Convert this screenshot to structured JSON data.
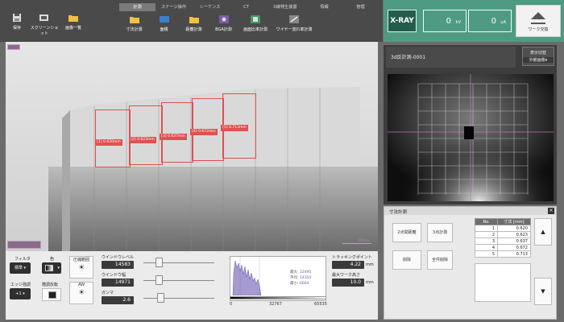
{
  "toolbar": {
    "left_buttons": [
      {
        "label": "保存",
        "icon": "save-icon"
      },
      {
        "label": "スクリーンショット",
        "icon": "screenshot-icon"
      },
      {
        "label": "画像一覧",
        "icon": "folder-icon"
      }
    ],
    "tabs": [
      "計測",
      "ステージ操作",
      "シーケンス",
      "CT",
      "X線発生装置",
      "情報",
      "管理"
    ],
    "active_tab": 0,
    "tools": [
      {
        "label": "寸法計測",
        "icon": "measure-icon"
      },
      {
        "label": "面積",
        "icon": "area-icon"
      },
      {
        "label": "距離計測",
        "icon": "distance-icon"
      },
      {
        "label": "BGA計測",
        "icon": "bga-icon"
      },
      {
        "label": "画面比率計測",
        "icon": "ratio-icon"
      },
      {
        "label": "ワイヤー流れ率計測",
        "icon": "wire-icon"
      }
    ]
  },
  "xray": {
    "badge": "X-RAY",
    "kv_value": "0",
    "kv_unit": "kV",
    "ua_value": "0",
    "ua_unit": "uA",
    "work_change": "ワーク交換"
  },
  "main_image": {
    "measurements": [
      {
        "label": "[1] 0.620mm"
      },
      {
        "label": "[2] 0.623mm"
      },
      {
        "label": "[3] 0.637mm"
      },
      {
        "label": "[4] 0.672mm"
      },
      {
        "label": "[5] 0.713mm"
      }
    ],
    "scale_label": "200um"
  },
  "controls": {
    "filter_label": "フィルタ",
    "filter_value": "標準",
    "color_label": "色",
    "edge_label": "エッジ強調",
    "edge_value": "+1",
    "invert_label": "階調反転",
    "contrast_label": "圧縮範囲",
    "aw_label": "AW",
    "window_level_label": "ウインドウレベル",
    "window_level_value": "14583",
    "window_width_label": "ウインドウ幅",
    "window_width_value": "14971",
    "gamma_label": "ガンマ",
    "gamma_value": "2.6"
  },
  "histogram": {
    "max_label": "最大:",
    "max_value": "22495",
    "mean_label": "平均:",
    "mean_value": "14354",
    "min_label": "最小:",
    "min_value": "6604",
    "axis_ticks": [
      "0",
      "32767",
      "65535"
    ]
  },
  "tracking": {
    "tracking_label": "トラッキングポイント",
    "tracking_value": "4.22",
    "tracking_unit": "mm",
    "max_work_label": "最大ワーク高さ",
    "max_work_value": "10.0",
    "max_work_unit": "mm"
  },
  "view_panel": {
    "title": "3d反計測-0001",
    "display_btn_line1": "表示切替",
    "display_btn_line2": "外観画像▾"
  },
  "measurement_panel": {
    "title": "寸法計測",
    "close": "×",
    "buttons": [
      "2点間距離",
      "3点計測",
      "削除",
      "全件削除"
    ],
    "table_headers": [
      "No.",
      "寸法 [mm]"
    ],
    "rows": [
      {
        "no": "1",
        "value": "0.620"
      },
      {
        "no": "2",
        "value": "0.623"
      },
      {
        "no": "3",
        "value": "0.637"
      },
      {
        "no": "4",
        "value": "0.672"
      },
      {
        "no": "5",
        "value": "0.713"
      }
    ],
    "up_arrow": "▲",
    "down_arrow": "▼"
  }
}
